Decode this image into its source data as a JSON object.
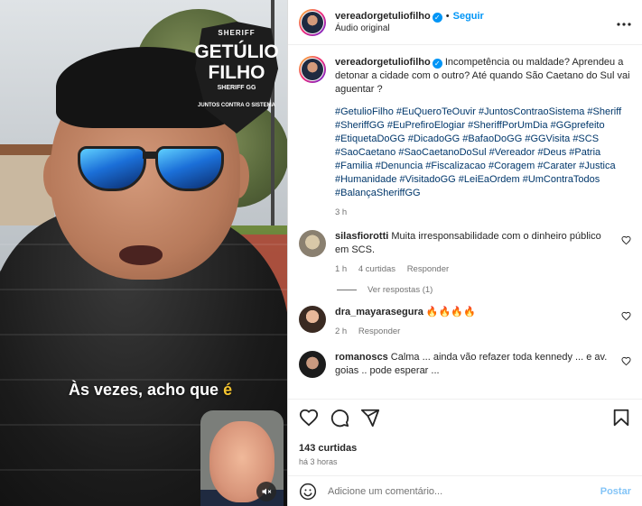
{
  "header": {
    "username": "vereadorgetuliofilho",
    "follow_label": "Seguir",
    "audio_label": "Áudio original",
    "more_icon": "more-horizontal-icon"
  },
  "media": {
    "logo": {
      "line1": "SHERIFF",
      "line2": "GETÚLIO",
      "line3": "FILHO",
      "line4": "SHERIFF GG",
      "line5": "JUNTOS CONTRA O SISTEMA"
    },
    "caption_text": "Às vezes, acho que ",
    "caption_highlight": "é",
    "mute_icon": "volume-muted-icon"
  },
  "post": {
    "username": "vereadorgetuliofilho",
    "text": "Incompetência ou maldade? Aprendeu a detonar a cidade com o outro? Até quando São Caetano do Sul vai aguentar ?",
    "hashtags": "#GetulioFilho #EuQueroTeOuvir #JuntosContraoSistema #Sheriff #SheriffGG #EuPrefiroElogiar #SheriffPorUmDia #GGprefeito #EtiquetaDoGG #DicadoGG #BafaoDoGG #GGVisita #SCS #SaoCaetano #SaoCaetanoDoSul #Vereador #Deus #Patria #Familia #Denuncia #Fiscalizacao #Coragem #Carater #Justica #Humanidade #VisitadoGG #LeiEaOrdem #UmContraTodos #BalançaSheriffGG",
    "time": "3 h"
  },
  "comments": [
    {
      "username": "silasfiorotti",
      "text": "Muita irresponsabilidade com o dinheiro público em SCS.",
      "time": "1 h",
      "likes": "4 curtidas",
      "reply_label": "Responder",
      "view_replies": "Ver respostas (1)"
    },
    {
      "username": "dra_mayarasegura",
      "text": "🔥🔥🔥🔥",
      "time": "2 h",
      "reply_label": "Responder"
    },
    {
      "username": "romanoscs",
      "text": "Calma ... ainda vão refazer toda kennedy ... e av. goias .. pode esperar ..."
    }
  ],
  "actions": {
    "likes": "143 curtidas",
    "time_ago": "há 3 horas",
    "icons": [
      "heart-icon",
      "comment-icon",
      "share-icon",
      "bookmark-icon"
    ]
  },
  "add_comment": {
    "placeholder": "Adicione um comentário...",
    "post_label": "Postar",
    "emoji_icon": "emoji-icon"
  },
  "colors": {
    "accent": "#0095f6",
    "hashtag": "#00376b",
    "secondary_text": "#737373",
    "caption_highlight": "#f4c430"
  }
}
